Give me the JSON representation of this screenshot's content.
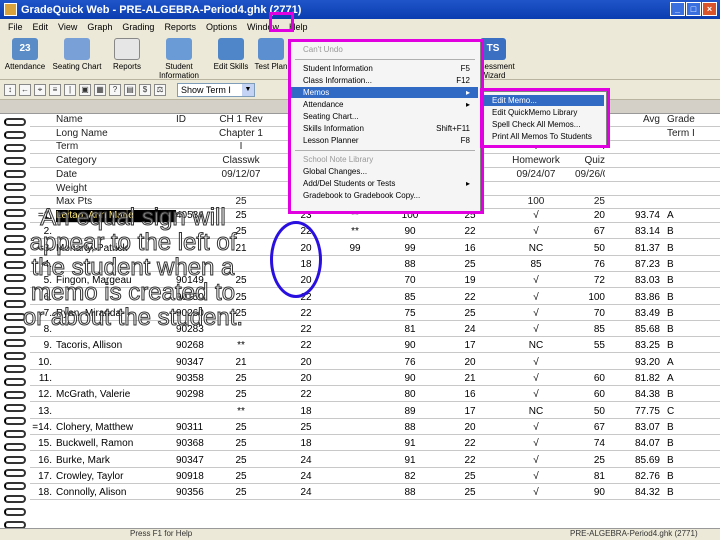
{
  "window": {
    "title": "GradeQuick Web - PRE-ALGEBRA-Period4.ghk (2771)"
  },
  "menubar": [
    "File",
    "Edit",
    "View",
    "Graph",
    "Grading",
    "Reports",
    "Options",
    "Window",
    "Help"
  ],
  "toolbar": [
    "Attendance",
    "Seating Chart",
    "Reports",
    "Student Information",
    "Edit Skills",
    "Test Plan",
    "",
    "",
    "",
    "",
    "Assessment Wizard"
  ],
  "toolbar_badge": "23",
  "term_select": "Show Term I",
  "columns": {
    "name": [
      "Name",
      "Long Name",
      "Term",
      "Category",
      "Date",
      "Weight",
      "Max Pts"
    ],
    "id": "ID",
    "ch1": [
      "CH 1 Rev",
      "Chapter 1",
      "I",
      "Classwk",
      "09/12/07",
      "",
      "25"
    ],
    "col3": [
      "",
      "",
      "",
      "",
      "",
      "",
      "25"
    ],
    "col4": [
      "",
      "",
      "",
      "",
      "",
      "",
      "100"
    ],
    "col5": [
      "",
      "",
      "",
      "",
      "",
      "",
      "100"
    ],
    "col6": [
      "",
      "",
      "",
      "",
      "",
      "",
      "25"
    ],
    "hw": [
      "",
      "",
      "I",
      "Homework",
      "09/24/07",
      "",
      "100"
    ],
    "quiz": [
      "oz",
      "",
      "I",
      "Quiz",
      "09/26/07",
      "",
      "25"
    ],
    "avg": [
      "Avg",
      "",
      "",
      "",
      "",
      "",
      ""
    ],
    "grade": [
      "Grade",
      "Term I",
      "",
      "",
      "",
      "",
      ""
    ]
  },
  "students": [
    {
      "num": "=1.",
      "name": "Leitao, Ann Marie",
      "id": "40534",
      "ch1": "25",
      "c3": "23",
      "c4": "**",
      "c5": "100",
      "c6": "25",
      "hw": "√",
      "quiz": "20",
      "avg": "93.74",
      "grade": "A"
    },
    {
      "num": "2.",
      "name": "",
      "id": "",
      "ch1": "25",
      "c3": "22",
      "c4": "**",
      "c5": "90",
      "c6": "22",
      "hw": "√",
      "quiz": "67",
      "avg": "83.14",
      "grade": "B"
    },
    {
      "num": "=3.",
      "name": "Moriarty, Patrick",
      "id": "",
      "ch1": "21",
      "c3": "20",
      "c4": "99",
      "c5": "99",
      "c6": "16",
      "hw": "NC",
      "quiz": "50",
      "avg": "81.37",
      "grade": "B"
    },
    {
      "num": "4.",
      "name": "",
      "id": "",
      "ch1": "",
      "c3": "18",
      "c4": "",
      "c5": "88",
      "c6": "25",
      "hw": "85",
      "quiz": "76",
      "avg": "87.23",
      "grade": "B"
    },
    {
      "num": "5.",
      "name": "Fingon, Margeau",
      "id": "90149",
      "ch1": "25",
      "c3": "20",
      "c4": "",
      "c5": "70",
      "c6": "19",
      "hw": "√",
      "quiz": "72",
      "avg": "83.03",
      "grade": "B"
    },
    {
      "num": "6.",
      "name": "",
      "id": "90150",
      "ch1": "25",
      "c3": "22",
      "c4": "",
      "c5": "85",
      "c6": "22",
      "hw": "√",
      "quiz": "100",
      "avg": "83.86",
      "grade": "B"
    },
    {
      "num": "7.",
      "name": "Ryan, Miranda",
      "id": "90260",
      "ch1": "25",
      "c3": "22",
      "c4": "",
      "c5": "75",
      "c6": "25",
      "hw": "√",
      "quiz": "70",
      "avg": "83.49",
      "grade": "B"
    },
    {
      "num": "8.",
      "name": "",
      "id": "90283",
      "ch1": "",
      "c3": "22",
      "c4": "",
      "c5": "81",
      "c6": "24",
      "hw": "√",
      "quiz": "85",
      "avg": "85.68",
      "grade": "B"
    },
    {
      "num": "9.",
      "name": "Tacoris, Allison",
      "id": "90268",
      "ch1": "**",
      "c3": "22",
      "c4": "",
      "c5": "90",
      "c6": "17",
      "hw": "NC",
      "quiz": "55",
      "avg": "83.25",
      "grade": "B"
    },
    {
      "num": "10.",
      "name": "",
      "id": "90347",
      "ch1": "21",
      "c3": "20",
      "c4": "",
      "c5": "76",
      "c6": "20",
      "hw": "√",
      "quiz": "",
      "avg": "93.20",
      "grade": "A"
    },
    {
      "num": "11.",
      "name": "",
      "id": "90358",
      "ch1": "25",
      "c3": "20",
      "c4": "",
      "c5": "90",
      "c6": "21",
      "hw": "√",
      "quiz": "60",
      "avg": "81.82",
      "grade": "A"
    },
    {
      "num": "12.",
      "name": "McGrath, Valerie",
      "id": "90298",
      "ch1": "25",
      "c3": "22",
      "c4": "",
      "c5": "80",
      "c6": "16",
      "hw": "√",
      "quiz": "60",
      "avg": "84.38",
      "grade": "B"
    },
    {
      "num": "13.",
      "name": "",
      "id": "",
      "ch1": "**",
      "c3": "18",
      "c4": "",
      "c5": "89",
      "c6": "17",
      "hw": "NC",
      "quiz": "50",
      "avg": "77.75",
      "grade": "C"
    },
    {
      "num": "=14.",
      "name": "Clohery, Matthew",
      "id": "90311",
      "ch1": "25",
      "c3": "25",
      "c4": "",
      "c5": "88",
      "c6": "20",
      "hw": "√",
      "quiz": "67",
      "avg": "83.07",
      "grade": "B"
    },
    {
      "num": "15.",
      "name": "Buckwell, Ramon",
      "id": "90368",
      "ch1": "25",
      "c3": "18",
      "c4": "",
      "c5": "91",
      "c6": "22",
      "hw": "√",
      "quiz": "74",
      "avg": "84.07",
      "grade": "B"
    },
    {
      "num": "16.",
      "name": "Burke, Mark",
      "id": "90347",
      "ch1": "25",
      "c3": "24",
      "c4": "",
      "c5": "91",
      "c6": "22",
      "hw": "√",
      "quiz": "25",
      "avg": "85.69",
      "grade": "B"
    },
    {
      "num": "17.",
      "name": "Crowley, Taylor",
      "id": "90918",
      "ch1": "25",
      "c3": "24",
      "c4": "",
      "c5": "82",
      "c6": "25",
      "hw": "√",
      "quiz": "81",
      "avg": "82.76",
      "grade": "B"
    },
    {
      "num": "18.",
      "name": "Connolly, Alison",
      "id": "90356",
      "ch1": "25",
      "c3": "24",
      "c4": "",
      "c5": "88",
      "c6": "25",
      "hw": "√",
      "quiz": "90",
      "avg": "84.32",
      "grade": "B"
    }
  ],
  "menu1": [
    {
      "label": "Can't Undo",
      "key": "",
      "disabled": true
    },
    {
      "sep": true
    },
    {
      "label": "Student Information",
      "key": "F5"
    },
    {
      "label": "Class Information...",
      "key": "F12"
    },
    {
      "label": "Memos",
      "key": "▸",
      "highlight": true
    },
    {
      "label": "Attendance",
      "key": "▸"
    },
    {
      "label": "Seating Chart...",
      "key": ""
    },
    {
      "label": "Skills Information",
      "key": "Shift+F11"
    },
    {
      "label": "Lesson Planner",
      "key": "F8"
    },
    {
      "sep": true
    },
    {
      "label": "School Note Library",
      "key": "",
      "disabled": true
    },
    {
      "label": "Global Changes...",
      "key": ""
    },
    {
      "label": "Add/Del Students or Tests",
      "key": "▸"
    },
    {
      "label": "Gradebook to Gradebook Copy...",
      "key": ""
    }
  ],
  "menu2": [
    "Edit Memo...",
    "Edit QuickMemo Library",
    "Spell Check All Memos...",
    "Print All Memos To Students"
  ],
  "caption": "An equal sign will appear to the left of the student when a memo is created to or about the student.",
  "status": {
    "left": "Press F1 for Help",
    "right": "PRE-ALGEBRA-Period4.ghk (2771)"
  }
}
